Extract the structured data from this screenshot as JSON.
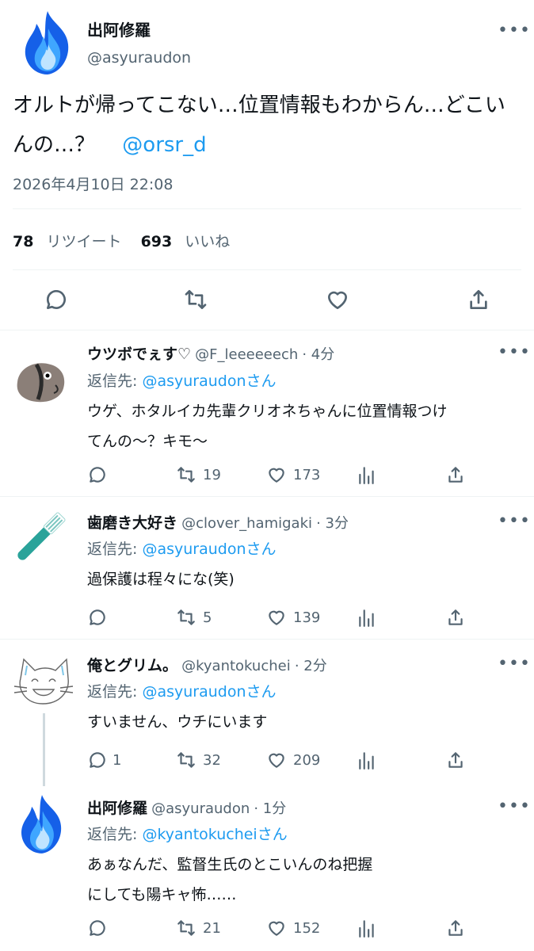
{
  "main_tweet": {
    "display_name": "出阿修羅",
    "handle": "@asyuraudon",
    "text": "オルトが帰ってこない…位置情報もわからん…どこいんの…？",
    "mention": "@orsr_d",
    "timestamp": "2026年4月10日 22:08",
    "retweet_count": "78",
    "retweet_label": "リツイート",
    "like_count": "693",
    "like_label": "いいね"
  },
  "replies": [
    {
      "display_name": "ウツボでぇす♡",
      "handle": "@F_leeeeeech",
      "time": "· 4分",
      "reply_to_label": "返信先:",
      "reply_to_handle": "@asyuraudon",
      "reply_to_suffix": "さん",
      "text_line1": "ウゲ、ホタルイカ先輩クリオネちゃんに位置情報つけ",
      "text_line2": "てんの〜？キモ〜",
      "reply_count": "",
      "retweet_count": "19",
      "like_count": "173"
    },
    {
      "display_name": "歯磨き大好き",
      "handle": "@clover_hamigaki",
      "time": "· 3分",
      "reply_to_label": "返信先:",
      "reply_to_handle": "@asyuraudon",
      "reply_to_suffix": "さん",
      "text_line1": "過保護は程々にな(笑)",
      "reply_count": "",
      "retweet_count": "5",
      "like_count": "139"
    },
    {
      "display_name": "俺とグリム。",
      "handle": "@kyantokuchei",
      "time": "· 2分",
      "reply_to_label": "返信先:",
      "reply_to_handle": "@asyuraudon",
      "reply_to_suffix": "さん",
      "text_line1": "すいません、ウチにいます",
      "reply_count": "1",
      "retweet_count": "32",
      "like_count": "209"
    },
    {
      "display_name": "出阿修羅",
      "handle": "@asyuraudon",
      "time": "· 1分",
      "reply_to_label": "返信先:",
      "reply_to_handle": "@kyantokuchei",
      "reply_to_suffix": "さん",
      "text_line1": "あぁなんだ、監督生氏のとこいんのね把握",
      "text_line2": "にしても陽キャ怖……",
      "reply_count": "",
      "retweet_count": "21",
      "like_count": "152"
    }
  ],
  "icons": {
    "more": "more-icon",
    "reply": "reply-icon",
    "retweet": "retweet-icon",
    "like": "heart-icon",
    "share": "share-icon",
    "analytics": "analytics-icon"
  },
  "colors": {
    "link": "#1d9bf0",
    "muted": "#536471",
    "text": "#0f1419",
    "divider": "#eff3f4"
  }
}
